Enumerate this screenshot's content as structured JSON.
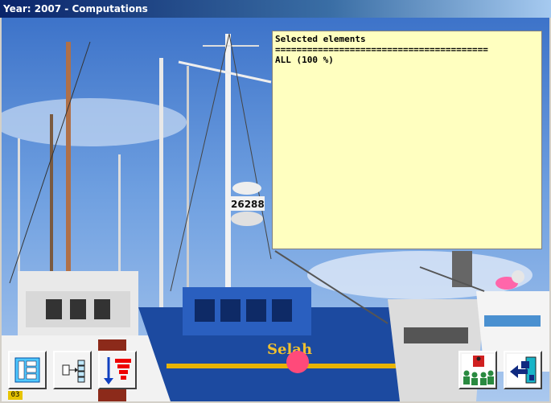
{
  "window": {
    "title": "Year: 2007 - Computations"
  },
  "selection_panel": {
    "heading": "Selected elements",
    "separator": "========================================",
    "items": [
      "ALL (100 %)"
    ]
  },
  "toolbar": {
    "icons": [
      "table-view-icon",
      "field-mapping-icon",
      "sort-descending-icon",
      "presentation-icon",
      "exit-icon"
    ]
  },
  "status": {
    "page_badge": "03"
  },
  "colors": {
    "panel_bg": "#ffffc0",
    "title_bar": "#0a246a",
    "badge": "#e7c400"
  }
}
